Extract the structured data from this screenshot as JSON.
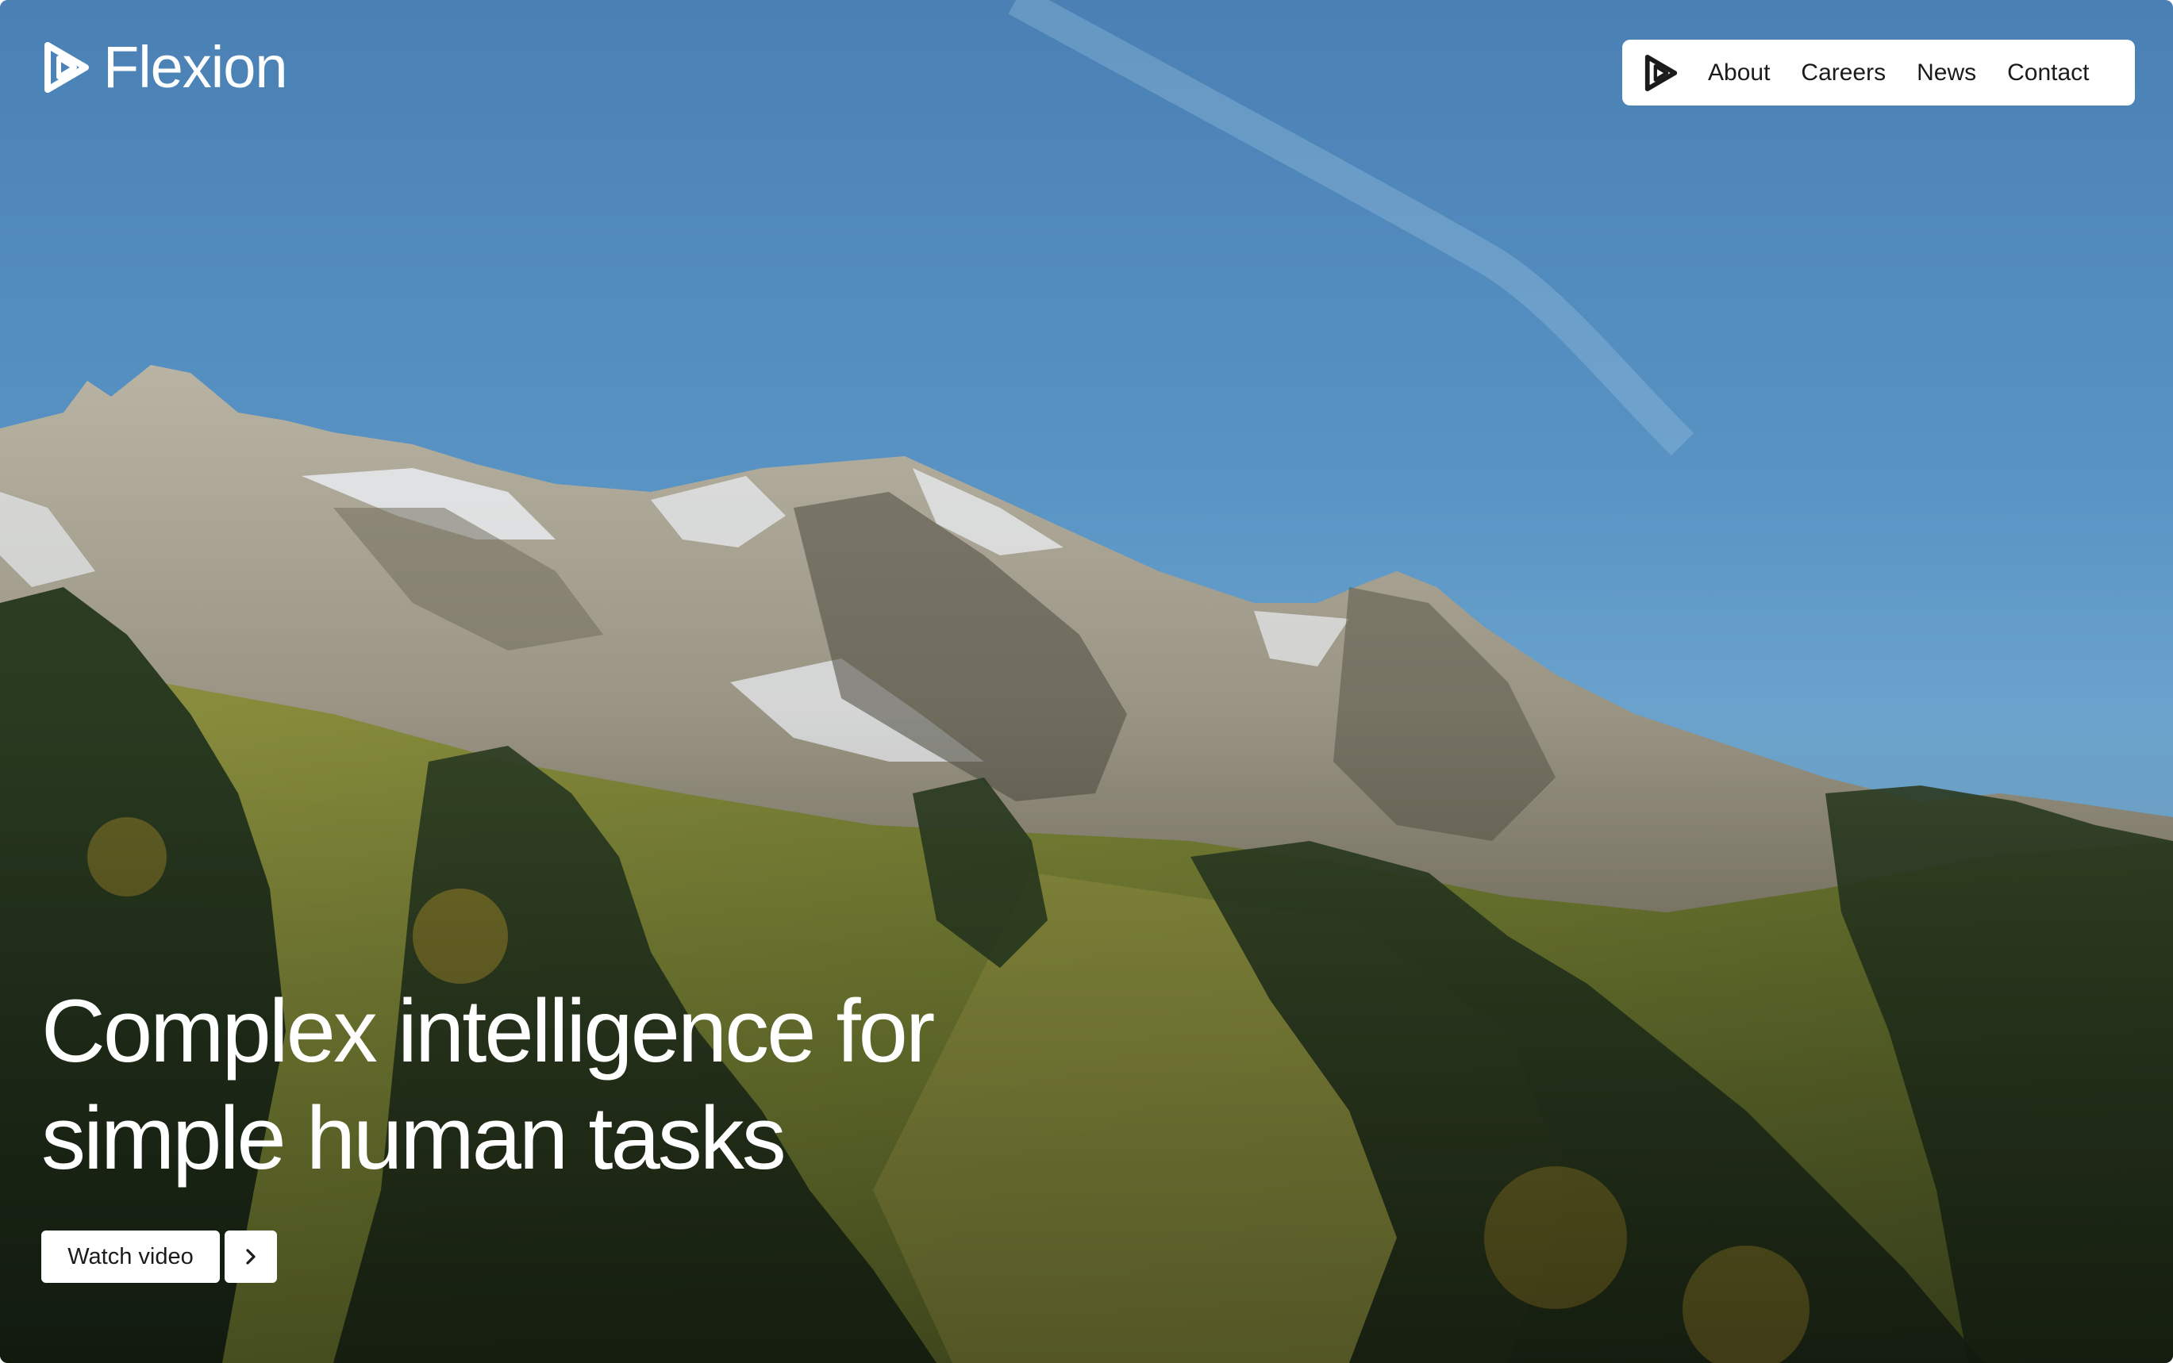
{
  "brand": {
    "name": "Flexion",
    "logo_icon": "flexion-logo-icon"
  },
  "nav": {
    "icon": "flexion-logo-icon",
    "items": [
      {
        "label": "About"
      },
      {
        "label": "Careers"
      },
      {
        "label": "News"
      },
      {
        "label": "Contact"
      }
    ]
  },
  "hero": {
    "headline_line_1": "Complex intelligence for",
    "headline_line_2": "simple human tasks",
    "background": "mountain-landscape-image",
    "cta": {
      "watch_label": "Watch video",
      "arrow_icon": "chevron-right-icon"
    }
  },
  "colors": {
    "sky": "#5b95c6",
    "text_on_image": "#ffffff",
    "nav_bg": "#ffffff",
    "nav_text": "#1b1b1b"
  }
}
